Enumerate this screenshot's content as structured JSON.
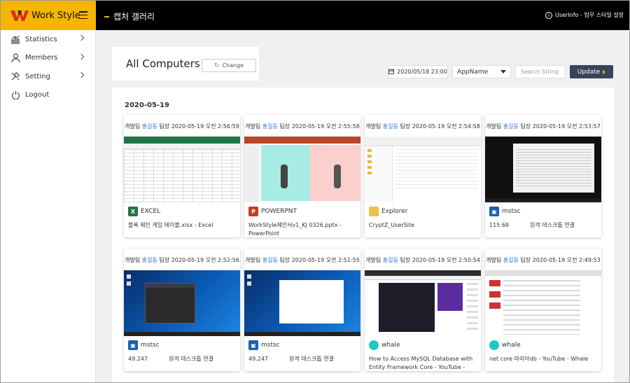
{
  "brand": {
    "name": "Work Style"
  },
  "header": {
    "title": "캡처 갤러리",
    "userinfo": "UserInfo - 업무 스타일 설정"
  },
  "sidebar": {
    "items": [
      {
        "label": "Statistics",
        "icon": "statistics-icon",
        "has_chevron": true
      },
      {
        "label": "Members",
        "icon": "members-icon",
        "has_chevron": true
      },
      {
        "label": "Setting",
        "icon": "setting-icon",
        "has_chevron": true
      },
      {
        "label": "Logout",
        "icon": "logout-icon",
        "has_chevron": false
      }
    ]
  },
  "toolbar": {
    "title": "All Computers",
    "change_label": "Change",
    "date": "2020/05/18 23:00",
    "app_select": "AppName",
    "search_placeholder": "Search String",
    "update_label": "Update"
  },
  "gallery": {
    "date": "2020-05-19",
    "cards": [
      {
        "team": "개발팀",
        "name": "홍길동",
        "role": "팀장",
        "time": "2020-05-19 오전 2:56:59",
        "app": "EXCEL",
        "app_icon": "excel-icon",
        "subtitle": "블록 체인 게임 테이블.xlsx - Excel",
        "subtitle_b": ""
      },
      {
        "team": "개발팀",
        "name": "홍길동",
        "role": "팀장",
        "time": "2020-05-19 오전 2:55:58",
        "app": "POWERPNT",
        "app_icon": "powerpoint-icon",
        "subtitle": "WorkStyle제안서v1_KJ 0326.pptx - PowerPoint",
        "subtitle_b": ""
      },
      {
        "team": "개발팀",
        "name": "홍길동",
        "role": "팀장",
        "time": "2020-05-19 오전 2:54:58",
        "app": "Explorer",
        "app_icon": "folder-icon",
        "subtitle": "CryptZ_UserSite",
        "subtitle_b": ""
      },
      {
        "team": "개발팀",
        "name": "홍길동",
        "role": "팀장",
        "time": "2020-05-19 오전 2:53:57",
        "app": "mstsc",
        "app_icon": "remote-desktop-icon",
        "subtitle": "115.68",
        "subtitle_b": "원격 데스크톱 연결"
      },
      {
        "team": "개발팀",
        "name": "홍길동",
        "role": "팀장",
        "time": "2020-05-19 오전 2:52:56",
        "app": "mstsc",
        "app_icon": "remote-desktop-icon",
        "subtitle": "49.247",
        "subtitle_b": "원격 데스크톱 연결"
      },
      {
        "team": "개발팀",
        "name": "홍길동",
        "role": "팀장",
        "time": "2020-05-19 오전 2:51:55",
        "app": "mstsc",
        "app_icon": "remote-desktop-icon",
        "subtitle": "49.247",
        "subtitle_b": "원격 데스크톱 연결"
      },
      {
        "team": "개발팀",
        "name": "홍길동",
        "role": "팀장",
        "time": "2020-05-19 오전 2:50:54",
        "app": "whale",
        "app_icon": "whale-icon",
        "subtitle": "How to Access MySQL Database with Entity Framework Core - YouTube - Whale",
        "subtitle_b": ""
      },
      {
        "team": "개발팀",
        "name": "홍길동",
        "role": "팀장",
        "time": "2020-05-19 오전 2:49:53",
        "app": "whale",
        "app_icon": "whale-icon",
        "subtitle": "net core 마리아db - YouTube - Whale",
        "subtitle_b": ""
      }
    ]
  },
  "colors": {
    "brand": "#f5b500",
    "topbar": "#000000",
    "update_button": "#39435a",
    "name_link": "#2f6fd3"
  }
}
